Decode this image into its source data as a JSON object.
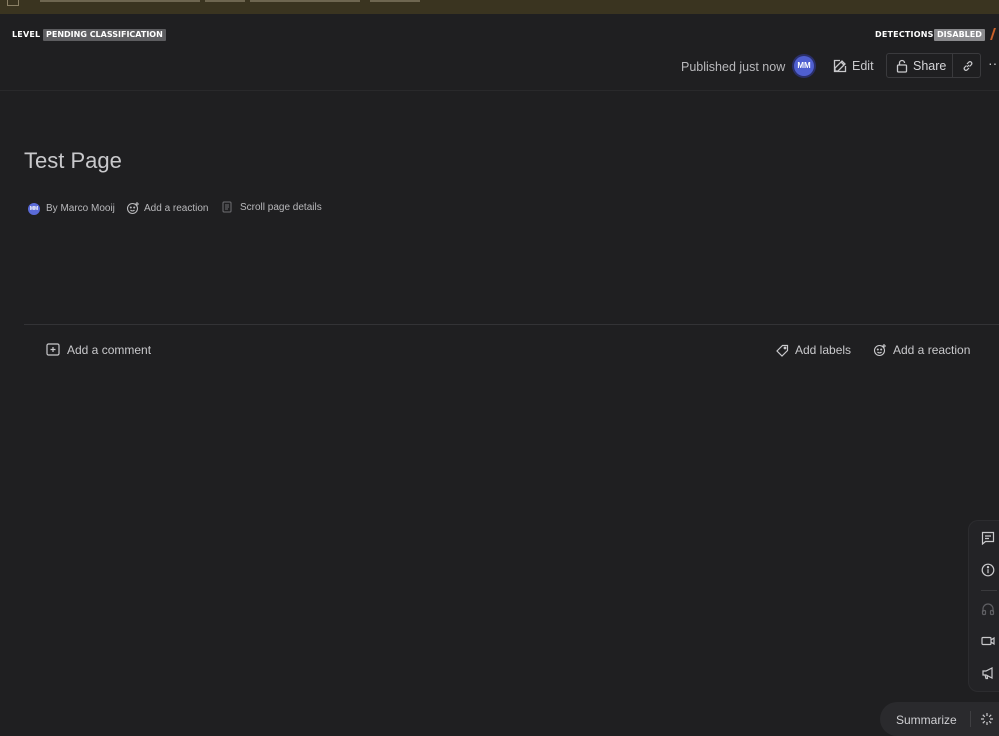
{
  "classification": {
    "level_label": "LEVEL",
    "level_value": "PENDING CLASSIFICATION",
    "detections_label": "DETECTIONS",
    "detections_value": "DISABLED"
  },
  "header": {
    "published": "Published just now",
    "avatar_initials": "MM",
    "edit_label": "Edit",
    "share_label": "Share"
  },
  "page": {
    "title": "Test Page",
    "author_initials": "MM",
    "byline": "By Marco Mooij",
    "add_reaction": "Add a reaction",
    "scroll_details": "Scroll page details"
  },
  "footer": {
    "add_comment": "Add a comment",
    "add_labels": "Add labels",
    "add_reaction": "Add a reaction"
  },
  "rail": {
    "icons": [
      "comment-icon",
      "info-icon",
      "headphones-icon",
      "video-icon",
      "megaphone-icon"
    ]
  },
  "summarize": {
    "label": "Summarize"
  },
  "colors": {
    "background": "#1f1f21",
    "avatar": "#4f5fd0",
    "text": "#c9c9cc"
  }
}
